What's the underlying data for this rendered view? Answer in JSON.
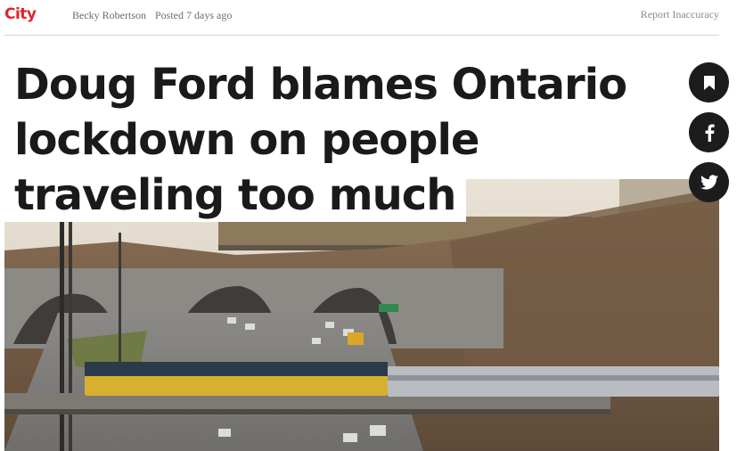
{
  "brand": {
    "logo_text": "City",
    "accent_color": "#e2232a"
  },
  "byline": {
    "author": "Becky Robertson",
    "posted": "Posted 7 days ago"
  },
  "actions": {
    "report_label": "Report Inaccuracy"
  },
  "article": {
    "headline": "Doug Ford blames Ontario lockdown on people traveling too much",
    "hero_image_alt": "Trains crossing a bridge over a busy highway with traffic"
  },
  "share": {
    "icons": [
      "bookmark-icon",
      "facebook-icon",
      "twitter-icon"
    ],
    "button_color": "#1c1c1c"
  }
}
